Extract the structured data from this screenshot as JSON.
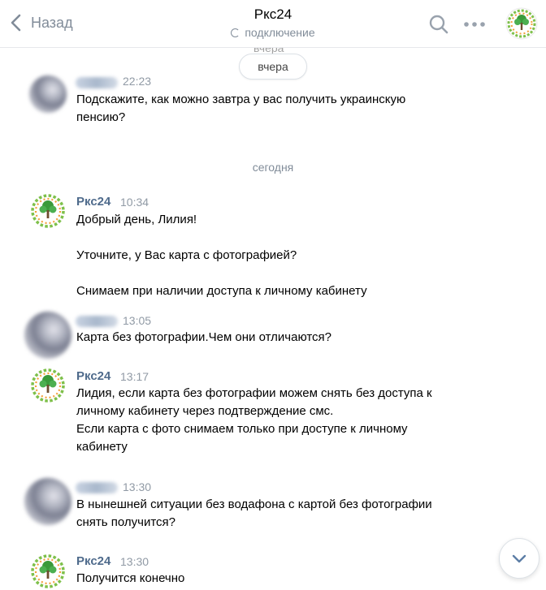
{
  "header": {
    "back_label": "Назад",
    "title": "Ркс24",
    "status": "подключение"
  },
  "chat": {
    "top_partial_text": "вчера",
    "day_pill": "вчера",
    "day_separator": "сегодня",
    "messages": [
      {
        "sender": "",
        "time": "22:23",
        "lines": [
          "Подскажите, как можно завтра у вас получить украинскую",
          "пенсию?"
        ]
      },
      {
        "sender": "Ркс24",
        "time": "10:34",
        "lines": [
          "Добрый день, Лилия!",
          "",
          "Уточните, у Вас карта с фотографией?",
          "",
          "Снимаем при наличии доступа к личному кабинету"
        ]
      },
      {
        "sender": "",
        "time": "13:05",
        "lines": [
          "Карта без фотографии.Чем они отличаются?"
        ]
      },
      {
        "sender": "Ркс24",
        "time": "13:17",
        "lines": [
          "Лидия, если карта без фотографии можем снять без доступа к",
          "личному кабинету через подтверждение смс.",
          "Если карта с фото снимаем только при доступе к личному",
          "кабинету"
        ]
      },
      {
        "sender": "",
        "time": "13:30",
        "lines": [
          "В нынешней ситуации без водафона с картой без фотографии",
          "снять получится?"
        ]
      },
      {
        "sender": "Ркс24",
        "time": "13:30",
        "lines": [
          "Получится конечно"
        ]
      }
    ]
  },
  "icons": {
    "back": "chevron-left-icon",
    "search": "search-icon",
    "more": "more-dots-icon",
    "scroll_down": "chevron-down-icon"
  },
  "colors": {
    "accent": "#4f6b8c",
    "muted": "#818c99",
    "logo_green": "#3a9a3a"
  }
}
